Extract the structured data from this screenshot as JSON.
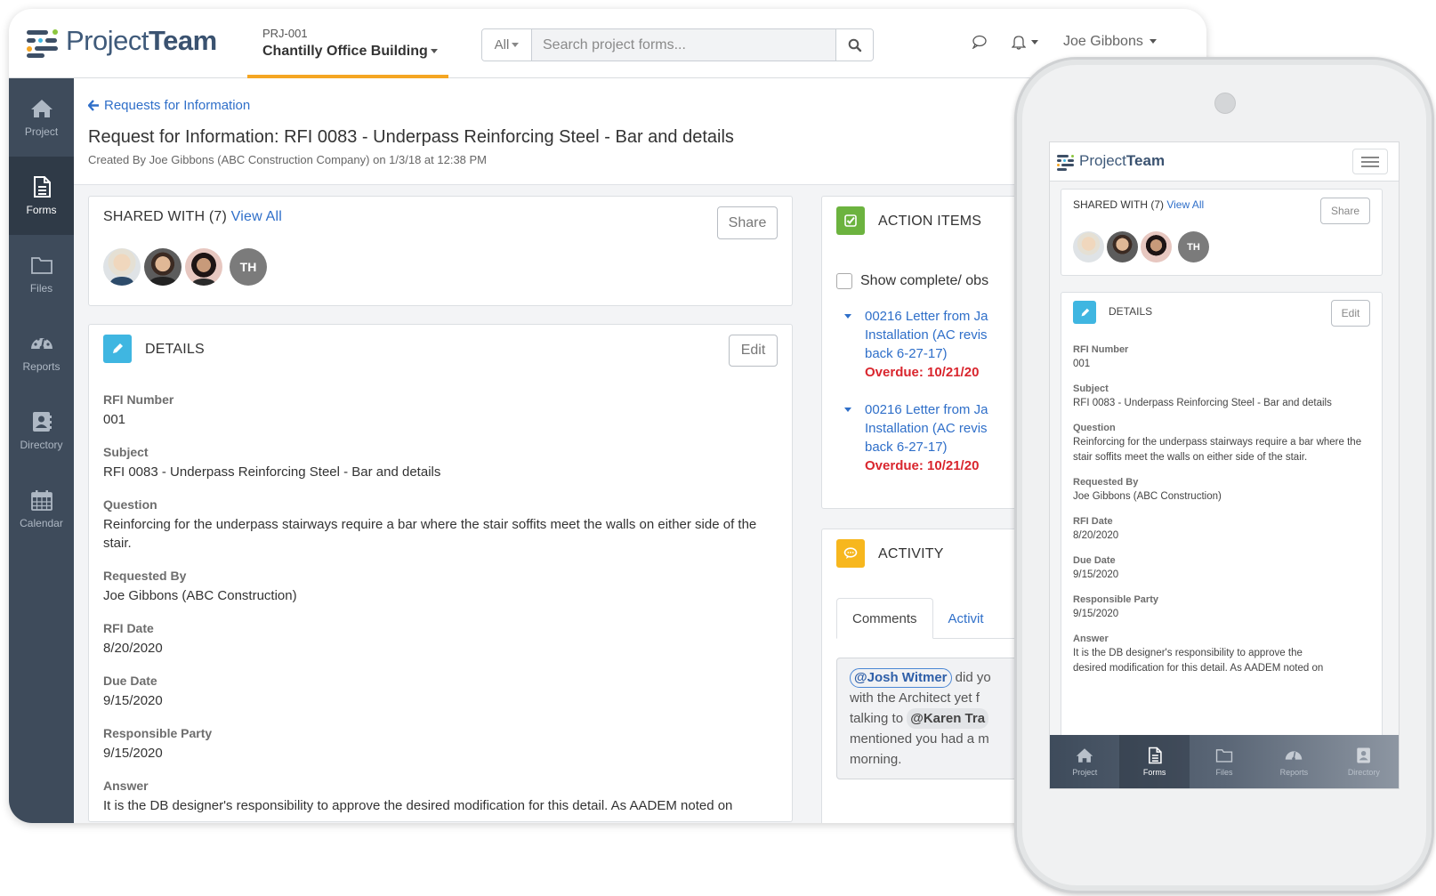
{
  "app": {
    "logo_prefix": "Project",
    "logo_suffix": "Team"
  },
  "project": {
    "code": "PRJ-001",
    "name": "Chantilly Office Building"
  },
  "search": {
    "scope": "All",
    "placeholder": "Search project forms..."
  },
  "user": {
    "name": "Joe Gibbons"
  },
  "sidebar": {
    "items": [
      {
        "label": "Project",
        "icon": "home-icon",
        "active": false
      },
      {
        "label": "Forms",
        "icon": "document-icon",
        "active": true
      },
      {
        "label": "Files",
        "icon": "folder-icon",
        "active": false
      },
      {
        "label": "Reports",
        "icon": "dashboard-icon",
        "active": false
      },
      {
        "label": "Directory",
        "icon": "contact-book-icon",
        "active": false
      },
      {
        "label": "Calendar",
        "icon": "calendar-icon",
        "active": false
      }
    ]
  },
  "header": {
    "back_label": "Requests for Information",
    "title": "Request for Information: RFI 0083 - Underpass Reinforcing Steel - Bar and details",
    "subtitle": "Created By Joe Gibbons (ABC Construction Company) on 1/3/18 at 12:38 PM"
  },
  "shared": {
    "label": "SHARED WITH (7)",
    "view_all": "View All",
    "share_button": "Share",
    "avatars": [
      {
        "type": "photo",
        "name": "user-1"
      },
      {
        "type": "photo",
        "name": "user-2"
      },
      {
        "type": "photo",
        "name": "user-3"
      },
      {
        "type": "initials",
        "initials": "TH"
      }
    ]
  },
  "details": {
    "title": "DETAILS",
    "edit_button": "Edit",
    "fields": [
      {
        "label": "RFI Number",
        "value": "001"
      },
      {
        "label": "Subject",
        "value": "RFI 0083 - Underpass Reinforcing Steel - Bar and details"
      },
      {
        "label": "Question",
        "value": "Reinforcing for the underpass stairways require a bar where the stair soffits meet the walls on either side of the stair."
      },
      {
        "label": "Requested By",
        "value": "Joe Gibbons (ABC Construction)"
      },
      {
        "label": "RFI Date",
        "value": "8/20/2020"
      },
      {
        "label": "Due Date",
        "value": "9/15/2020"
      },
      {
        "label": "Responsible Party",
        "value": "9/15/2020"
      },
      {
        "label": "Answer",
        "value": "It is the DB designer's responsibility to approve the desired modification for this detail. As AADEM noted on"
      }
    ]
  },
  "action_items": {
    "title": "ACTION ITEMS",
    "show_complete_label": "Show complete/ obs",
    "items": [
      {
        "text": "00216 Letter from Ja Installation (AC revis back 6-27-17)",
        "line1": "00216 Letter from Ja",
        "line2": "Installation (AC revis",
        "line3": "back 6-27-17)",
        "due": "Overdue: 10/21/20"
      },
      {
        "text": "00216 Letter from Ja Installation (AC revis back 6-27-17)",
        "line1": "00216 Letter from Ja",
        "line2": "Installation (AC revis",
        "line3": "back 6-27-17)",
        "due": "Overdue: 10/21/20"
      }
    ]
  },
  "activity": {
    "title": "ACTIVITY",
    "tabs": [
      {
        "label": "Comments",
        "active": true
      },
      {
        "label": "Activit",
        "active": false
      }
    ],
    "comment": {
      "mention1": "@Josh Witmer",
      "text1": " did yo",
      "text2": "with the Architect yet f",
      "text3": "talking to ",
      "mention2": "@Karen Tra",
      "text4": "mentioned you had a m",
      "text5": "morning."
    }
  },
  "mobile": {
    "tabbar": [
      {
        "label": "Project",
        "active": false
      },
      {
        "label": "Forms",
        "active": true
      },
      {
        "label": "Files",
        "active": false
      },
      {
        "label": "Reports",
        "active": false
      },
      {
        "label": "Directory",
        "active": false
      }
    ],
    "answer_line1": "It is the DB designer's responsibility to approve the",
    "answer_line2": "desired modification for this detail. As AADEM noted on"
  },
  "colors": {
    "accent_blue": "#2f6fc9",
    "sidebar_bg": "#3e4b5b",
    "project_underline": "#f5a623",
    "details_icon": "#3fb6e1",
    "action_icon": "#6cb33f",
    "activity_icon": "#f7b71e",
    "overdue": "#d9262e"
  }
}
